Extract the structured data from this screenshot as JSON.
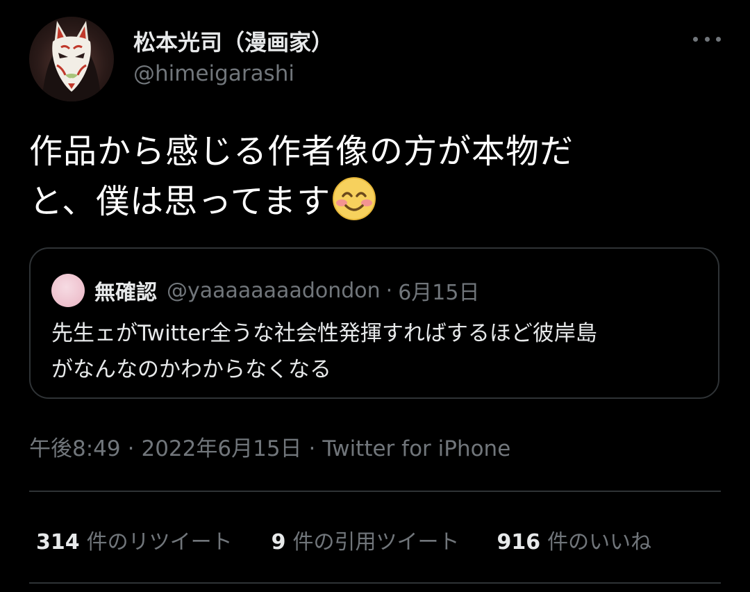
{
  "author": {
    "display_name": "松本光司（漫画家）",
    "handle": "@himeigarashi",
    "avatar_icon": "fox-mask-avatar"
  },
  "more_icon": "more-horizontal-icon",
  "tweet": {
    "text_line1": "作品から感じる作者像の方が本物だ",
    "text_line2": "と、僕は思ってます",
    "emoji": "smiling-face-with-smiling-eyes"
  },
  "quote": {
    "display_name": "無確認",
    "handle": "@yaaaaaaaadondon",
    "separator": "·",
    "date": "6月15日",
    "text_line1": "先生ェがTwitter全うな社会性発揮すればするほど彼岸島",
    "text_line2": "がなんなのかわからなくなる"
  },
  "meta": {
    "time": "午後8:49",
    "separator": "·",
    "date": "2022年6月15日",
    "source": "Twitter for iPhone"
  },
  "stats": {
    "retweets_count": "314",
    "retweets_label": "件のリツイート",
    "quotes_count": "9",
    "quotes_label": "件の引用ツイート",
    "likes_count": "916",
    "likes_label": "件のいいね"
  },
  "colors": {
    "background": "#000000",
    "primary_text": "#e7e9ea",
    "secondary_text": "#71767b",
    "border": "#2f3336"
  }
}
